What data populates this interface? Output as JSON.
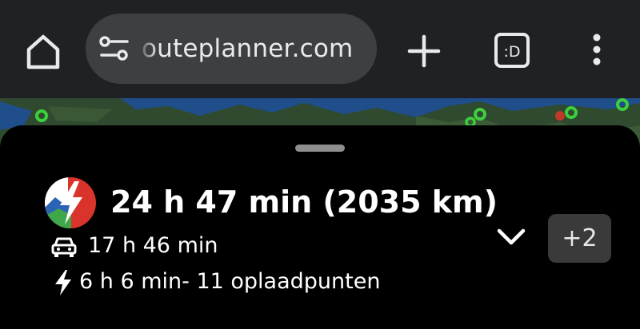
{
  "browser": {
    "url": "outeplanner.com",
    "tab_count_label": ":D",
    "icons": {
      "home": "home-icon",
      "site_settings": "tune-icon",
      "new_tab": "plus-icon",
      "tabs": "tabs-icon",
      "menu": "more-vert-icon"
    }
  },
  "route": {
    "total_summary": "24 h 47 min (2035 km)",
    "drive_time": "17 h 46 min",
    "charging_summary": "6 h 6 min- 11 oplaadpunten",
    "more_routes_label": "+2",
    "icons": {
      "logo": "abrp-logo-icon",
      "drive": "car-icon",
      "charge": "lightning-icon",
      "expand": "chevron-down-icon"
    }
  },
  "colors": {
    "browser_bar": "#202124",
    "url_field": "#3c4043",
    "sheet": "#000000",
    "map_water": "#1f4e8a",
    "map_land": "#2f4a2e",
    "charger_marker": "#3ecf3e",
    "logo_red": "#d9342b"
  }
}
